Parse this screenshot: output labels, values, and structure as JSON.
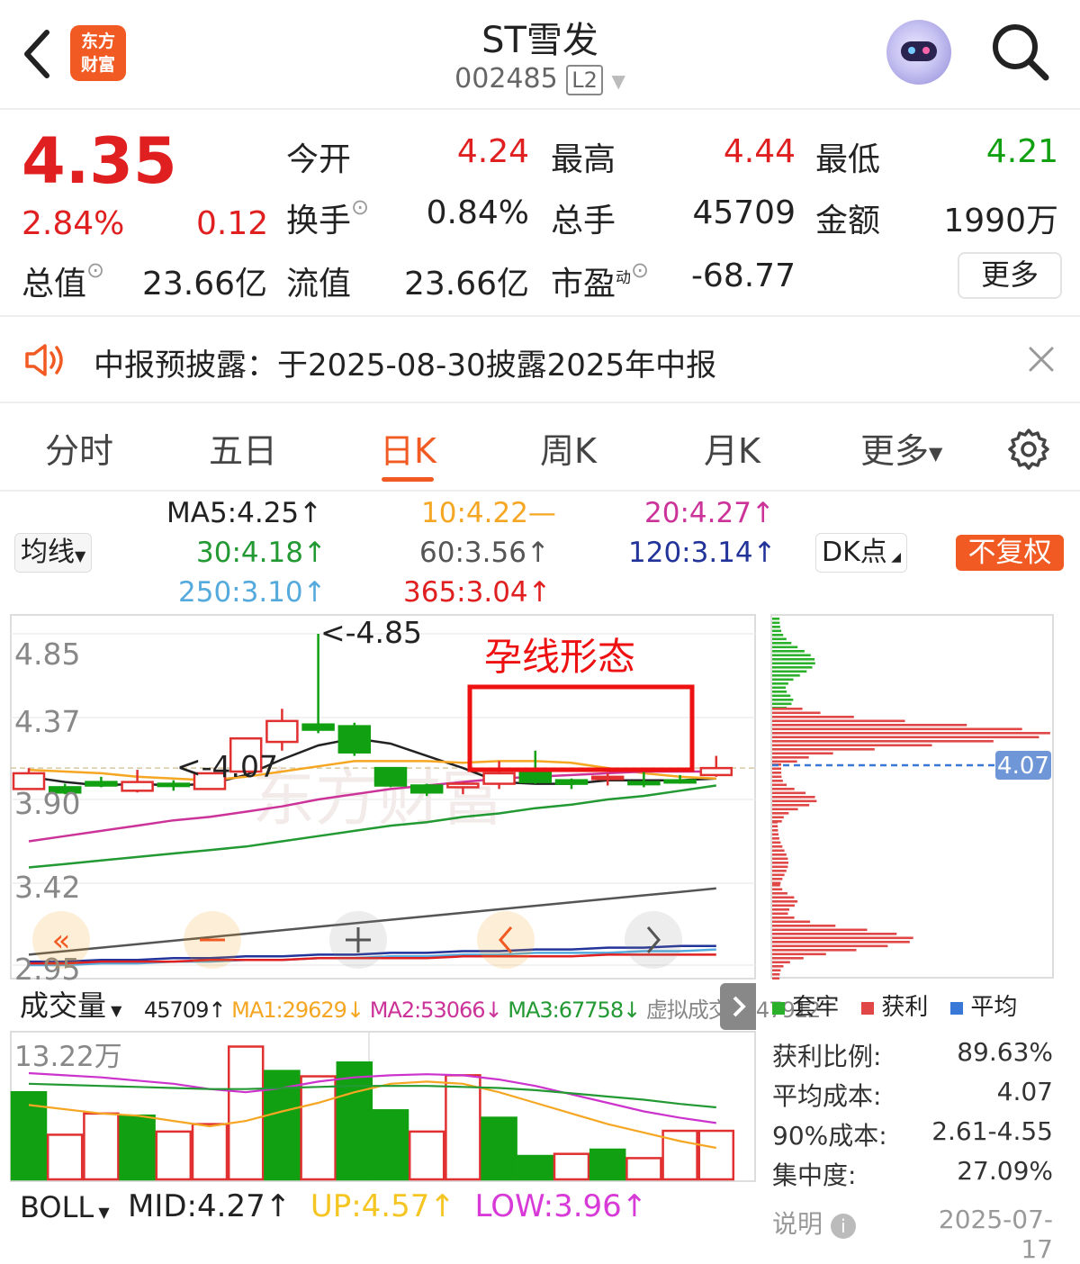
{
  "header": {
    "title": "ST雪发",
    "code": "002485",
    "level": "L2",
    "logo_line1": "东方",
    "logo_line2": "财富"
  },
  "quote": {
    "price": "4.35",
    "change_pct": "2.84%",
    "change": "0.12",
    "open_label": "今开",
    "open": "4.24",
    "high_label": "最高",
    "high": "4.44",
    "low_label": "最低",
    "low": "4.21",
    "turnover_label": "换手",
    "turnover": "0.84%",
    "volume_label": "总手",
    "volume": "45709",
    "amount_label": "金额",
    "amount": "1990万",
    "mktcap_label": "总值",
    "mktcap": "23.66亿",
    "float_label": "流值",
    "float_cap": "23.66亿",
    "pe_label": "市盈",
    "pe_sup": "动",
    "pe": "-68.77",
    "more": "更多"
  },
  "notice": {
    "text": "中报预披露：于2025-08-30披露2025年中报"
  },
  "tabs": [
    "分时",
    "五日",
    "日K",
    "周K",
    "月K",
    "更多"
  ],
  "active_tab": "日K",
  "ma": {
    "selector": "均线",
    "ma5": "MA5:4.25↑",
    "ma10": "10:4.22—",
    "ma20": "20:4.27↑",
    "ma30": "30:4.18↑",
    "ma60": "60:3.56↑",
    "ma120": "120:3.14↑",
    "ma250": "250:3.10↑",
    "ma365": "365:3.04↑",
    "dk": "DK点",
    "fuquan": "不复权"
  },
  "colors": {
    "up": "#e02020",
    "down": "#11a011",
    "accent": "#f15a22",
    "ma5": "#222222",
    "ma10": "#f5a623",
    "ma20": "#cc3399",
    "ma30": "#229933",
    "ma60": "#555555",
    "ma120": "#223399",
    "ma250": "#55aadd",
    "ma365": "#e02020"
  },
  "chart_data": [
    {
      "type": "candlestick",
      "y_ticks": [
        "4.85",
        "4.37",
        "3.90",
        "3.42",
        "2.95"
      ],
      "ylim": [
        2.95,
        4.85
      ],
      "annotations": [
        "<-4.85",
        "<-4.07",
        "孕线形态"
      ],
      "candles": [
        {
          "o": 3.96,
          "c": 4.05,
          "h": 4.08,
          "l": 3.96
        },
        {
          "o": 3.97,
          "c": 3.94,
          "h": 3.99,
          "l": 3.93
        },
        {
          "o": 4.0,
          "c": 3.98,
          "h": 4.03,
          "l": 3.97
        },
        {
          "o": 3.95,
          "c": 4.0,
          "h": 4.07,
          "l": 3.94
        },
        {
          "o": 3.99,
          "c": 3.98,
          "h": 4.01,
          "l": 3.95
        },
        {
          "o": 3.96,
          "c": 4.05,
          "h": 4.05,
          "l": 3.96
        },
        {
          "o": 4.06,
          "c": 4.25,
          "h": 4.25,
          "l": 4.06
        },
        {
          "o": 4.23,
          "c": 4.35,
          "h": 4.42,
          "l": 4.18
        },
        {
          "o": 4.33,
          "c": 4.3,
          "h": 4.85,
          "l": 4.28
        },
        {
          "o": 4.32,
          "c": 4.17,
          "h": 4.34,
          "l": 4.15
        },
        {
          "o": 4.08,
          "c": 3.98,
          "h": 4.08,
          "l": 3.97
        },
        {
          "o": 3.98,
          "c": 3.94,
          "h": 3.99,
          "l": 3.92
        },
        {
          "o": 3.97,
          "c": 3.99,
          "h": 4.0,
          "l": 3.93
        },
        {
          "o": 3.99,
          "c": 4.05,
          "h": 4.12,
          "l": 3.96
        },
        {
          "o": 4.06,
          "c": 4.0,
          "h": 4.18,
          "l": 3.99
        },
        {
          "o": 4.01,
          "c": 3.99,
          "h": 4.02,
          "l": 3.96
        },
        {
          "o": 4.02,
          "c": 4.03,
          "h": 4.05,
          "l": 3.98
        },
        {
          "o": 4.0,
          "c": 3.99,
          "h": 4.06,
          "l": 3.97
        },
        {
          "o": 4.01,
          "c": 4.0,
          "h": 4.04,
          "l": 3.99
        },
        {
          "o": 4.04,
          "c": 4.08,
          "h": 4.15,
          "l": 4.03
        }
      ],
      "ma_lines": [
        {
          "name": "MA5",
          "values": [
            4.03,
            4.0,
            3.98,
            3.99,
            3.98,
            3.99,
            4.04,
            4.13,
            4.21,
            4.25,
            4.22,
            4.15,
            4.08,
            4.0,
            3.99,
            3.99,
            4.01,
            4.01,
            4.01,
            4.02
          ]
        },
        {
          "name": "10",
          "values": [
            4.07,
            4.06,
            4.05,
            4.03,
            4.02,
            4.01,
            4.03,
            4.06,
            4.09,
            4.12,
            4.12,
            4.12,
            4.11,
            4.12,
            4.12,
            4.11,
            4.08,
            4.05,
            4.03,
            4.02
          ]
        },
        {
          "name": "20",
          "values": [
            3.66,
            3.69,
            3.72,
            3.75,
            3.78,
            3.8,
            3.83,
            3.86,
            3.9,
            3.93,
            3.96,
            3.98,
            4.0,
            4.02,
            4.03,
            4.04,
            4.05,
            4.06,
            4.06,
            4.06
          ]
        },
        {
          "name": "30",
          "values": [
            3.51,
            3.53,
            3.55,
            3.57,
            3.59,
            3.61,
            3.63,
            3.66,
            3.69,
            3.72,
            3.75,
            3.77,
            3.8,
            3.82,
            3.85,
            3.87,
            3.9,
            3.92,
            3.95,
            3.98
          ]
        },
        {
          "name": "60",
          "values": [
            3.01,
            3.03,
            3.05,
            3.07,
            3.09,
            3.11,
            3.13,
            3.15,
            3.17,
            3.19,
            3.21,
            3.23,
            3.25,
            3.27,
            3.29,
            3.31,
            3.33,
            3.35,
            3.37,
            3.39
          ]
        },
        {
          "name": "120",
          "values": [
            2.97,
            2.97,
            2.98,
            2.98,
            2.99,
            2.99,
            3.0,
            3.0,
            3.01,
            3.01,
            3.02,
            3.02,
            3.03,
            3.03,
            3.04,
            3.04,
            3.05,
            3.05,
            3.06,
            3.06
          ]
        },
        {
          "name": "250",
          "values": [
            2.95,
            2.95,
            2.96,
            2.96,
            2.97,
            2.97,
            2.98,
            2.98,
            2.99,
            2.99,
            3.0,
            3.0,
            3.01,
            3.01,
            3.02,
            3.02,
            3.02,
            3.03,
            3.03,
            3.04
          ]
        },
        {
          "name": "365",
          "values": [
            2.96,
            2.96,
            2.97,
            2.97,
            2.97,
            2.98,
            2.98,
            2.98,
            2.99,
            2.99,
            2.99,
            2.99,
            3.0,
            3.0,
            3.0,
            3.0,
            3.01,
            3.01,
            3.01,
            3.01
          ]
        }
      ]
    },
    {
      "type": "bar",
      "title": "成交量",
      "y_ticks": [
        "13.22万"
      ],
      "ylim": [
        0,
        132200
      ],
      "values": [
        82000,
        42000,
        62000,
        60000,
        45000,
        52000,
        125000,
        102000,
        97000,
        110000,
        65000,
        45000,
        98000,
        58000,
        22000,
        24000,
        28000,
        20000,
        45709,
        45709
      ],
      "up": [
        false,
        true,
        true,
        false,
        true,
        true,
        true,
        false,
        true,
        false,
        false,
        true,
        true,
        false,
        false,
        true,
        false,
        true,
        true,
        true
      ],
      "ma_lines": [
        {
          "name": "MA1",
          "values": [
            70000,
            66000,
            62000,
            60000,
            55000,
            50000,
            55000,
            64000,
            72000,
            82000,
            90000,
            92000,
            90000,
            82000,
            72000,
            62000,
            52000,
            44000,
            36000,
            29629
          ]
        },
        {
          "name": "MA2",
          "values": [
            100000,
            98000,
            96000,
            93000,
            90000,
            85000,
            82000,
            86000,
            92000,
            96000,
            98000,
            99000,
            98000,
            94000,
            88000,
            80000,
            72000,
            64000,
            58000,
            53066
          ]
        },
        {
          "name": "MA3",
          "values": [
            90000,
            89000,
            88000,
            87000,
            86000,
            85000,
            85000,
            86000,
            87000,
            88000,
            88000,
            88000,
            87000,
            86000,
            84000,
            81000,
            78000,
            75000,
            71000,
            67758
          ]
        }
      ]
    },
    {
      "type": "bar",
      "title": "chip-distribution",
      "avg_cost": "4.07",
      "legend": [
        "套牢",
        "获利",
        "平均"
      ]
    }
  ],
  "volume": {
    "selector": "成交量",
    "vol": "45709↑",
    "ma1": "MA1:29629↓",
    "ma2": "MA2:53066↓",
    "ma3": "MA3:67758↓",
    "virtual": "虚拟成交量:47912"
  },
  "boll": {
    "selector": "BOLL",
    "mid": "MID:4.27↑",
    "up": "UP:4.57↑",
    "low": "LOW:3.96↑"
  },
  "chips": {
    "legend_trapped": "套牢",
    "legend_profit": "获利",
    "legend_avg": "平均",
    "profit_ratio_label": "获利比例:",
    "profit_ratio": "89.63%",
    "avg_cost_label": "平均成本:",
    "avg_cost": "4.07",
    "cost90_label": "90%成本:",
    "cost90": "2.61-4.55",
    "concentration_label": "集中度:",
    "concentration": "27.09%",
    "explain": "说明",
    "date": "2025-07-17",
    "avg_price_tag": "4.07"
  },
  "watermark": "东方财富"
}
